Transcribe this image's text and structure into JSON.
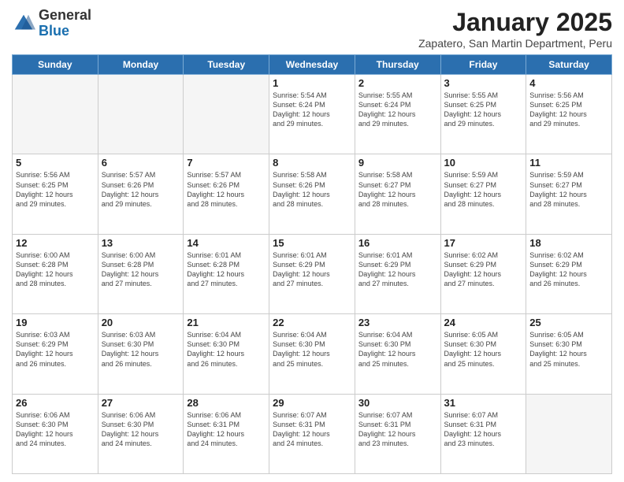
{
  "logo": {
    "general": "General",
    "blue": "Blue"
  },
  "header": {
    "title": "January 2025",
    "subtitle": "Zapatero, San Martin Department, Peru"
  },
  "days_of_week": [
    "Sunday",
    "Monday",
    "Tuesday",
    "Wednesday",
    "Thursday",
    "Friday",
    "Saturday"
  ],
  "weeks": [
    [
      {
        "day": "",
        "info": ""
      },
      {
        "day": "",
        "info": ""
      },
      {
        "day": "",
        "info": ""
      },
      {
        "day": "1",
        "info": "Sunrise: 5:54 AM\nSunset: 6:24 PM\nDaylight: 12 hours\nand 29 minutes."
      },
      {
        "day": "2",
        "info": "Sunrise: 5:55 AM\nSunset: 6:24 PM\nDaylight: 12 hours\nand 29 minutes."
      },
      {
        "day": "3",
        "info": "Sunrise: 5:55 AM\nSunset: 6:25 PM\nDaylight: 12 hours\nand 29 minutes."
      },
      {
        "day": "4",
        "info": "Sunrise: 5:56 AM\nSunset: 6:25 PM\nDaylight: 12 hours\nand 29 minutes."
      }
    ],
    [
      {
        "day": "5",
        "info": "Sunrise: 5:56 AM\nSunset: 6:25 PM\nDaylight: 12 hours\nand 29 minutes."
      },
      {
        "day": "6",
        "info": "Sunrise: 5:57 AM\nSunset: 6:26 PM\nDaylight: 12 hours\nand 29 minutes."
      },
      {
        "day": "7",
        "info": "Sunrise: 5:57 AM\nSunset: 6:26 PM\nDaylight: 12 hours\nand 28 minutes."
      },
      {
        "day": "8",
        "info": "Sunrise: 5:58 AM\nSunset: 6:26 PM\nDaylight: 12 hours\nand 28 minutes."
      },
      {
        "day": "9",
        "info": "Sunrise: 5:58 AM\nSunset: 6:27 PM\nDaylight: 12 hours\nand 28 minutes."
      },
      {
        "day": "10",
        "info": "Sunrise: 5:59 AM\nSunset: 6:27 PM\nDaylight: 12 hours\nand 28 minutes."
      },
      {
        "day": "11",
        "info": "Sunrise: 5:59 AM\nSunset: 6:27 PM\nDaylight: 12 hours\nand 28 minutes."
      }
    ],
    [
      {
        "day": "12",
        "info": "Sunrise: 6:00 AM\nSunset: 6:28 PM\nDaylight: 12 hours\nand 28 minutes."
      },
      {
        "day": "13",
        "info": "Sunrise: 6:00 AM\nSunset: 6:28 PM\nDaylight: 12 hours\nand 27 minutes."
      },
      {
        "day": "14",
        "info": "Sunrise: 6:01 AM\nSunset: 6:28 PM\nDaylight: 12 hours\nand 27 minutes."
      },
      {
        "day": "15",
        "info": "Sunrise: 6:01 AM\nSunset: 6:29 PM\nDaylight: 12 hours\nand 27 minutes."
      },
      {
        "day": "16",
        "info": "Sunrise: 6:01 AM\nSunset: 6:29 PM\nDaylight: 12 hours\nand 27 minutes."
      },
      {
        "day": "17",
        "info": "Sunrise: 6:02 AM\nSunset: 6:29 PM\nDaylight: 12 hours\nand 27 minutes."
      },
      {
        "day": "18",
        "info": "Sunrise: 6:02 AM\nSunset: 6:29 PM\nDaylight: 12 hours\nand 26 minutes."
      }
    ],
    [
      {
        "day": "19",
        "info": "Sunrise: 6:03 AM\nSunset: 6:29 PM\nDaylight: 12 hours\nand 26 minutes."
      },
      {
        "day": "20",
        "info": "Sunrise: 6:03 AM\nSunset: 6:30 PM\nDaylight: 12 hours\nand 26 minutes."
      },
      {
        "day": "21",
        "info": "Sunrise: 6:04 AM\nSunset: 6:30 PM\nDaylight: 12 hours\nand 26 minutes."
      },
      {
        "day": "22",
        "info": "Sunrise: 6:04 AM\nSunset: 6:30 PM\nDaylight: 12 hours\nand 25 minutes."
      },
      {
        "day": "23",
        "info": "Sunrise: 6:04 AM\nSunset: 6:30 PM\nDaylight: 12 hours\nand 25 minutes."
      },
      {
        "day": "24",
        "info": "Sunrise: 6:05 AM\nSunset: 6:30 PM\nDaylight: 12 hours\nand 25 minutes."
      },
      {
        "day": "25",
        "info": "Sunrise: 6:05 AM\nSunset: 6:30 PM\nDaylight: 12 hours\nand 25 minutes."
      }
    ],
    [
      {
        "day": "26",
        "info": "Sunrise: 6:06 AM\nSunset: 6:30 PM\nDaylight: 12 hours\nand 24 minutes."
      },
      {
        "day": "27",
        "info": "Sunrise: 6:06 AM\nSunset: 6:30 PM\nDaylight: 12 hours\nand 24 minutes."
      },
      {
        "day": "28",
        "info": "Sunrise: 6:06 AM\nSunset: 6:31 PM\nDaylight: 12 hours\nand 24 minutes."
      },
      {
        "day": "29",
        "info": "Sunrise: 6:07 AM\nSunset: 6:31 PM\nDaylight: 12 hours\nand 24 minutes."
      },
      {
        "day": "30",
        "info": "Sunrise: 6:07 AM\nSunset: 6:31 PM\nDaylight: 12 hours\nand 23 minutes."
      },
      {
        "day": "31",
        "info": "Sunrise: 6:07 AM\nSunset: 6:31 PM\nDaylight: 12 hours\nand 23 minutes."
      },
      {
        "day": "",
        "info": ""
      }
    ]
  ]
}
